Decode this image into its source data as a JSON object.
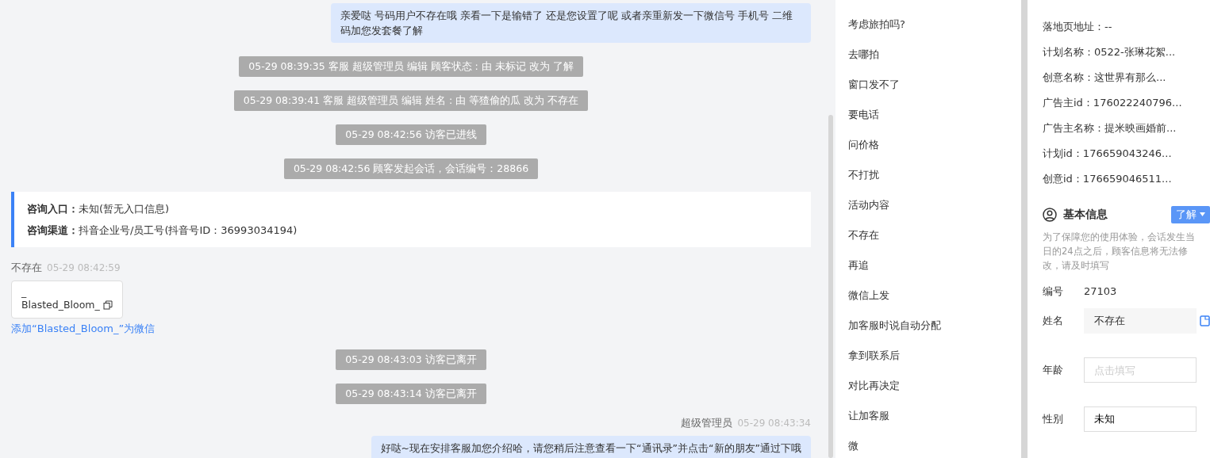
{
  "chat": {
    "messages": [
      {
        "kind": "outgoing",
        "text": "亲爱哒 号码用户不存在哦 亲看一下是输错了 还是您设置了呢 或者亲重新发一下微信号 手机号 二维码加您发套餐了解"
      },
      {
        "kind": "system",
        "text": "05-29 08:39:35 客服 超级管理员 编辑 顾客状态 :  由 未标记 改为 了解"
      },
      {
        "kind": "system",
        "text": "05-29 08:39:41 客服 超级管理员 编辑 姓名 :  由 等猹偷的瓜 改为 不存在"
      },
      {
        "kind": "system",
        "text": "05-29 08:42:56 访客已进线"
      },
      {
        "kind": "system",
        "text": "05-29 08:42:56 顾客发起会话，会话编号：28866"
      },
      {
        "kind": "source",
        "rows": [
          {
            "label": "咨询入口：",
            "value": "未知(暂无入口信息)"
          },
          {
            "label": "咨询渠道：",
            "value": "抖音企业号/员工号(抖音号ID：36993034194)"
          }
        ]
      },
      {
        "kind": "card",
        "sender": "不存在",
        "time": "05-29 08:42:59",
        "lines": [
          "_",
          "Blasted_Bloom_"
        ],
        "link": "添加“Blasted_Bloom_”为微信"
      },
      {
        "kind": "system",
        "text": "05-29 08:43:03 访客已离开"
      },
      {
        "kind": "system",
        "text": "05-29 08:43:14 访客已离开"
      },
      {
        "kind": "outgoing",
        "sender": "超级管理员",
        "time": "05-29 08:43:34",
        "text": "好哒~现在安排客服加您介绍哈，请您稍后注意查看一下“通讯录”并点击“新的朋友”通过下哦"
      }
    ]
  },
  "quick_replies": [
    "考虑旅拍吗?",
    "去哪拍",
    "窗口发不了",
    "要电话",
    "问价格",
    "不打扰",
    "活动内容",
    "不存在",
    "再追",
    "微信上发",
    "加客服时说自动分配",
    "拿到联系后",
    "对比再决定",
    "让加客服",
    "微"
  ],
  "ad_info": [
    "落地页地址：--",
    "计划名称：0522-张琳花絮...",
    "创意名称：这世界有那么...",
    "广告主id：176022240796...",
    "广告主名称：提米映画婚前...",
    "计划id：176659043246...",
    "创意id：176659046511..."
  ],
  "basic_info": {
    "title": "基本信息",
    "status": "了解",
    "note": "为了保障您的使用体验，会话发生当日的24点之后，顾客信息将无法修改，请及时填写",
    "fields": [
      {
        "kind": "text",
        "label": "编号",
        "value": "27103"
      },
      {
        "kind": "readonly",
        "label": "姓名",
        "value": "不存在"
      },
      {
        "kind": "input",
        "label": "年龄",
        "placeholder": "点击填写"
      },
      {
        "kind": "input",
        "label": "性别",
        "value": "未知"
      }
    ]
  }
}
